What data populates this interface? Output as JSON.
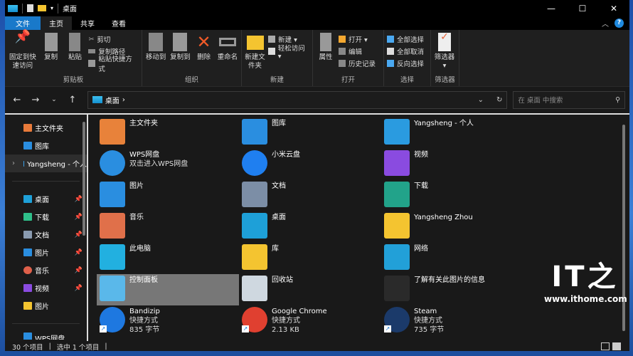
{
  "window": {
    "title": "桌面",
    "controls": {
      "minimize": "—",
      "maximize": "☐",
      "close": "✕"
    }
  },
  "tabs": [
    {
      "label": "文件"
    },
    {
      "label": "主页"
    },
    {
      "label": "共享"
    },
    {
      "label": "查看"
    }
  ],
  "help": "?",
  "ribbon": {
    "clipboard": {
      "label": "剪贴板",
      "pin": "固定到快速访问",
      "copy": "复制",
      "paste": "粘贴",
      "cut": "剪切",
      "copy_path": "复制路径",
      "paste_shortcut": "粘贴快捷方式"
    },
    "organize": {
      "label": "组织",
      "move_to": "移动到",
      "copy_to": "复制到",
      "delete": "删除",
      "rename": "重命名"
    },
    "new": {
      "label": "新建",
      "new_folder": "新建文件夹",
      "new_item": "新建 ▾",
      "easy_access": "轻松访问 ▾"
    },
    "open": {
      "label": "打开",
      "properties": "属性",
      "open": "打开 ▾",
      "edit": "编辑",
      "history": "历史记录"
    },
    "select": {
      "label": "选择",
      "select_all": "全部选择",
      "select_none": "全部取消",
      "invert": "反向选择"
    },
    "filter": {
      "label": "筛选器",
      "filter": "筛选器 ▾"
    }
  },
  "address": {
    "path": "桌面",
    "search_placeholder": "在 桌面 中搜索"
  },
  "sidebar": {
    "top": [
      {
        "label": "主文件夹",
        "color": "#e87a3a"
      },
      {
        "label": "图库",
        "color": "#2a8ee0"
      },
      {
        "label": "Yangsheng - 个人",
        "color": "#3ba0e8"
      }
    ],
    "pinned": [
      {
        "label": "桌面",
        "color": "#1ea0d8"
      },
      {
        "label": "下载",
        "color": "#2fbf8a"
      },
      {
        "label": "文档",
        "color": "#8a9bb0"
      },
      {
        "label": "图片",
        "color": "#2a8ee0"
      },
      {
        "label": "音乐",
        "color": "#e0604a"
      },
      {
        "label": "视频",
        "color": "#8a4be0"
      },
      {
        "label": "图片",
        "color": "#f4c430"
      }
    ],
    "bottom": "WPS网盘"
  },
  "items": [
    {
      "name": "主文件夹",
      "icon": "home-icon",
      "color": "#e8823a"
    },
    {
      "name": "图库",
      "icon": "gallery-icon",
      "color": "#2a8ee0"
    },
    {
      "name": "Yangsheng - 个人",
      "icon": "onedrive-folder-icon",
      "color": "#2a9be0"
    },
    {
      "name": "WPS网盘",
      "sub": "双击进入WPS网盘",
      "icon": "wps-cloud-icon",
      "color": "#2a8ee0"
    },
    {
      "name": "小米云盘",
      "icon": "mi-cloud-icon",
      "color": "#1f7ff0"
    },
    {
      "name": "视频",
      "icon": "videos-folder-icon",
      "color": "#8a4be0"
    },
    {
      "name": "图片",
      "icon": "pictures-folder-icon",
      "color": "#2a8ee0"
    },
    {
      "name": "文档",
      "icon": "documents-folder-icon",
      "color": "#7c8ea6"
    },
    {
      "name": "下载",
      "icon": "downloads-folder-icon",
      "color": "#22a38a"
    },
    {
      "name": "音乐",
      "icon": "music-folder-icon",
      "color": "#e0704a"
    },
    {
      "name": "桌面",
      "icon": "desktop-folder-icon",
      "color": "#1ea0d8"
    },
    {
      "name": "Yangsheng Zhou",
      "icon": "user-folder-icon",
      "color": "#f4c430"
    },
    {
      "name": "此电脑",
      "icon": "this-pc-icon",
      "color": "#22b0e0"
    },
    {
      "name": "库",
      "icon": "libraries-folder-icon",
      "color": "#f4c430"
    },
    {
      "name": "网络",
      "icon": "network-icon",
      "color": "#22a0d8"
    },
    {
      "name": "控制面板",
      "icon": "control-panel-icon",
      "color": "#5ab8ea",
      "selected": true
    },
    {
      "name": "回收站",
      "icon": "recycle-bin-icon",
      "color": "#cfd8e0"
    },
    {
      "name": "了解有关此图片的信息",
      "icon": "spotlight-info-icon",
      "color": "#2a2a2a"
    },
    {
      "name": "Bandizip",
      "sub": "快捷方式",
      "size": "835 字节",
      "icon": "bandizip-icon",
      "color": "#1e78e0",
      "shortcut": true
    },
    {
      "name": "Google Chrome",
      "sub": "快捷方式",
      "size": "2.13 KB",
      "icon": "chrome-icon",
      "color": "#e04030",
      "shortcut": true
    },
    {
      "name": "Steam",
      "sub": "快捷方式",
      "size": "735 字节",
      "icon": "steam-icon",
      "color": "#1b3a6a",
      "shortcut": true
    }
  ],
  "status": {
    "count": "30 个项目",
    "selected": "选中 1 个项目"
  },
  "watermark": {
    "logo": "IT之家",
    "url": "www.ithome.com"
  }
}
